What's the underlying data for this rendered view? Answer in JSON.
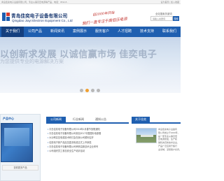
{
  "topbar": {
    "left": "青岛佳奕电子设备有限公司，专业从事高压电源等产品，电话：0532-8…",
    "right": "设为首页 | 加入收藏"
  },
  "header": {
    "company_cn": "青岛佳奕电子设备有限公司",
    "company_en": "Qingdao Jiayi Electron Equipment Co., Ltd",
    "slogan_line1": "自2000年开始",
    "slogan_line2": "我们一直专注于高低压电源",
    "search_label": "全站搜索关键词",
    "search_placeholder": "请输入关键词",
    "search_button": "搜索"
  },
  "nav": {
    "items": [
      {
        "label": "关于我们",
        "active": true
      },
      {
        "label": "公司产品",
        "active": false
      },
      {
        "label": "新闻资讯",
        "active": false
      },
      {
        "label": "案例展示",
        "active": false
      },
      {
        "label": "服务客户",
        "active": false
      },
      {
        "label": "人才招聘",
        "active": false
      },
      {
        "label": "技术支持",
        "active": false
      },
      {
        "label": "联系我们",
        "active": false
      }
    ]
  },
  "banner": {
    "title": "以创新求发展 以诚信赢市场 佳奕电子",
    "subtitle": "为您提供专业的电源解决方案"
  },
  "products": {
    "title": "产品中心",
    "more": "查看更多产品"
  },
  "news": {
    "tabs": [
      {
        "label": "公司新闻",
        "active": true
      },
      {
        "label": "行业新闻",
        "active": false
      },
      {
        "label": "通知公告",
        "active": false
      }
    ],
    "items": [
      "青岛佳奕电子设备有限公司2018年1月春节放假通知",
      "青岛佳奕电子设备有限公司参加2017中国国际电源展",
      "大功率高压电源技术研讨会在我公司顺利召开",
      "佳奕电子新产品高压直流电源正式上市销售",
      "青岛佳奕电子设备有限公司荣获高新技术企业称号",
      "公司组织员工参加安全生产培训活动"
    ]
  },
  "about": {
    "tab": "关于佳奕",
    "lines": [
      "青岛佳奕电子设备有",
      "限公司成立于2000年，",
      "是一家专业从事高低",
      "压电源研发、生产和",
      "销售的高新技术企业，",
      "产品广泛应用于各行",
      "业领域，深受客户好评。"
    ]
  }
}
